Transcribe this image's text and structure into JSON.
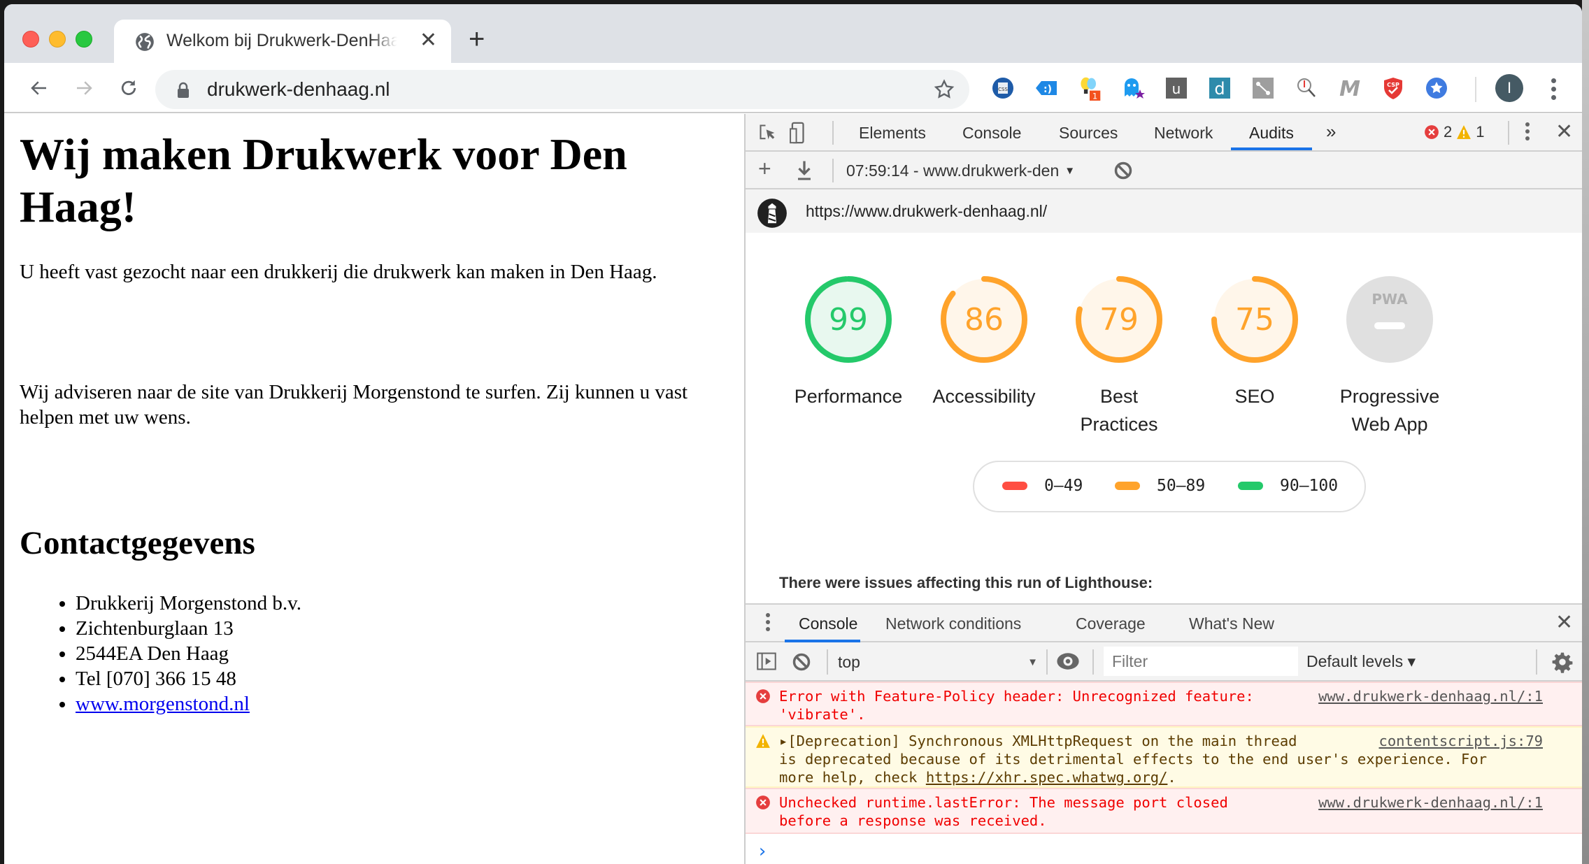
{
  "browser": {
    "tab": {
      "title": "Welkom bij Drukwerk-DenHaag",
      "favicon": "globe-icon"
    },
    "new_tab_label": "+",
    "address": "drukwerk-denhaag.nl",
    "extensions": [
      {
        "name": "css-viewer-extension",
        "glyph": "CSS"
      },
      {
        "name": "tag-extension",
        "glyph": ":)"
      },
      {
        "name": "lightbulb-extension",
        "badge": "1"
      },
      {
        "name": "ghostery-extension",
        "glyph": ""
      },
      {
        "name": "u-extension",
        "glyph": "u"
      },
      {
        "name": "d-extension",
        "glyph": "d"
      },
      {
        "name": "connect-extension",
        "glyph": ""
      },
      {
        "name": "inspect-extension",
        "glyph": ""
      },
      {
        "name": "m-extension",
        "glyph": "M"
      },
      {
        "name": "csp-extension",
        "glyph": "CSP"
      },
      {
        "name": "star-extension",
        "glyph": "★"
      }
    ],
    "profile_initial": "I"
  },
  "page": {
    "heading": "Wij maken Drukwerk voor Den Haag!",
    "paragraph1": "U heeft vast gezocht naar een drukkerij die drukwerk kan maken in Den Haag.",
    "paragraph2": "Wij adviseren naar de site van Drukkerij Morgenstond te surfen. Zij kunnen u vast helpen met uw wens.",
    "contact_heading": "Contactgegevens",
    "contact_items": [
      "Drukkerij Morgenstond b.v.",
      "Zichtenburglaan 13",
      "2544EA Den Haag",
      "Tel [070] 366 15 48"
    ],
    "contact_link": "www.morgenstond.nl"
  },
  "devtools": {
    "tabs": [
      "Elements",
      "Console",
      "Sources",
      "Network",
      "Audits"
    ],
    "active_tab": "Audits",
    "more_tabs": "»",
    "error_count": "2",
    "warning_count": "1",
    "audit_report_select": "07:59:14 - www.drukwerk-den",
    "audited_url": "https://www.drukwerk-denhaag.nl/",
    "scores": [
      {
        "label": "Performance",
        "score": 99,
        "display": "99",
        "rating": "pass"
      },
      {
        "label": "Accessibility",
        "score": 86,
        "display": "86",
        "rating": "average"
      },
      {
        "label": "Best Practices",
        "score": 79,
        "display": "79",
        "rating": "average"
      },
      {
        "label": "SEO",
        "score": 75,
        "display": "75",
        "rating": "average"
      },
      {
        "label": "Progressive Web App",
        "score": null,
        "display": "PWA",
        "rating": "na"
      }
    ],
    "legend": [
      {
        "range": "0–49",
        "color": "#ff4e42"
      },
      {
        "range": "50–89",
        "color": "#ffa400"
      },
      {
        "range": "90–100",
        "color": "#0cce6b"
      }
    ],
    "colors": {
      "pass": "#24c96a",
      "average": "#ffa32b",
      "fail": "#ff4e42",
      "na": "#e0e0e0",
      "accent": "#1a73e8"
    },
    "issues_text": "There were issues affecting this run of Lighthouse:",
    "drawer": {
      "tabs": [
        "Console",
        "Network conditions",
        "Coverage",
        "What's New"
      ],
      "active_tab": "Console",
      "context": "top",
      "filter_placeholder": "Filter",
      "levels": "Default levels ▾"
    },
    "console_messages": [
      {
        "level": "error",
        "text": "Error with Feature-Policy header: Unrecognized feature:\n'vibrate'.",
        "source": "www.drukwerk-denhaag.nl/:1"
      },
      {
        "level": "warning",
        "text_prefix": "▸[Deprecation] Synchronous XMLHttpRequest on the main thread\nis deprecated because of its detrimental effects to the end user's experience. For\nmore help, check ",
        "link": "https://xhr.spec.whatwg.org/",
        "text_suffix": ".",
        "source": "contentscript.js:79"
      },
      {
        "level": "error",
        "text": "Unchecked runtime.lastError: The message port closed\nbefore a response was received.",
        "source": "www.drukwerk-denhaag.nl/:1"
      }
    ],
    "prompt": "›"
  }
}
